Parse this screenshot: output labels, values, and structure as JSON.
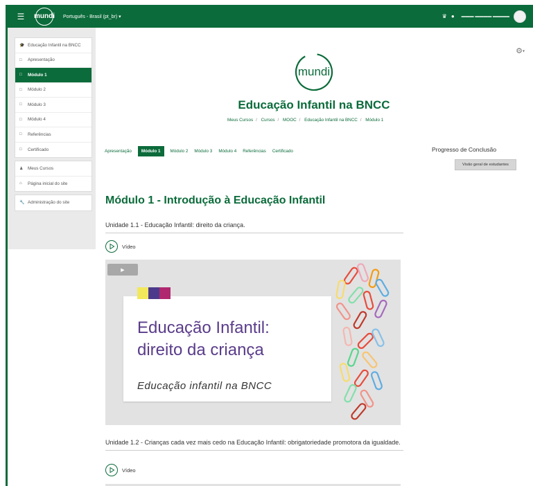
{
  "nav": {
    "logo_text": "mundi",
    "language": "Português - Brasil (pt_br) ▾"
  },
  "sidebar": {
    "group1": [
      {
        "label": "Educação Infantil na BNCC",
        "icon": "graduation-cap-icon"
      },
      {
        "label": "Apresentação",
        "icon": "folder-icon"
      },
      {
        "label": "Módulo 1",
        "icon": "folder-icon",
        "active": true
      },
      {
        "label": "Módulo 2",
        "icon": "folder-icon"
      },
      {
        "label": "Módulo 3",
        "icon": "folder-icon"
      },
      {
        "label": "Módulo 4",
        "icon": "folder-icon"
      },
      {
        "label": "Referências",
        "icon": "folder-icon"
      },
      {
        "label": "Certificado",
        "icon": "folder-icon"
      }
    ],
    "group2": [
      {
        "label": "Meus Cursos",
        "icon": "users-icon"
      },
      {
        "label": "Página inicial do site",
        "icon": "home-icon"
      }
    ],
    "group3": [
      {
        "label": "Administração do site",
        "icon": "wrench-icon"
      }
    ]
  },
  "course": {
    "logo_text": "mundi",
    "title": "Educação Infantil na BNCC",
    "breadcrumb": [
      "Meus Cursos",
      "Cursos",
      "MOOC",
      "Educação Infantil na BNCC",
      "Módulo 1"
    ]
  },
  "tabs": [
    "Apresentação",
    "Módulo 1",
    "Módulo 2",
    "Módulo 3",
    "Módulo 4",
    "Referências",
    "Certificado"
  ],
  "active_tab": "Módulo 1",
  "progress": {
    "title": "Progresso de Conclusão",
    "button": "Visão geral de estudantes"
  },
  "module": {
    "title": "Módulo 1 - Introdução à Educação Infantil",
    "units": [
      {
        "title": "Unidade 1.1 - Educação Infantil: direito da criança.",
        "resource": "Vídeo"
      },
      {
        "title": "Unidade 1.2 - Crianças cada vez mais cedo na Educação Infantil: obrigatoriedade promotora da igualdade.",
        "resource": "Vídeo"
      }
    ]
  },
  "video_thumb": {
    "title_line1": "Educação Infantil:",
    "title_line2": "direito da criança",
    "subtitle": "Educação infantil na BNCC"
  },
  "colors": {
    "brand_green": "#0b6b3a",
    "title_purple": "#5a3c8a",
    "square1": "#f2e85c",
    "square2": "#4b3a8c",
    "square3": "#b0276f"
  }
}
